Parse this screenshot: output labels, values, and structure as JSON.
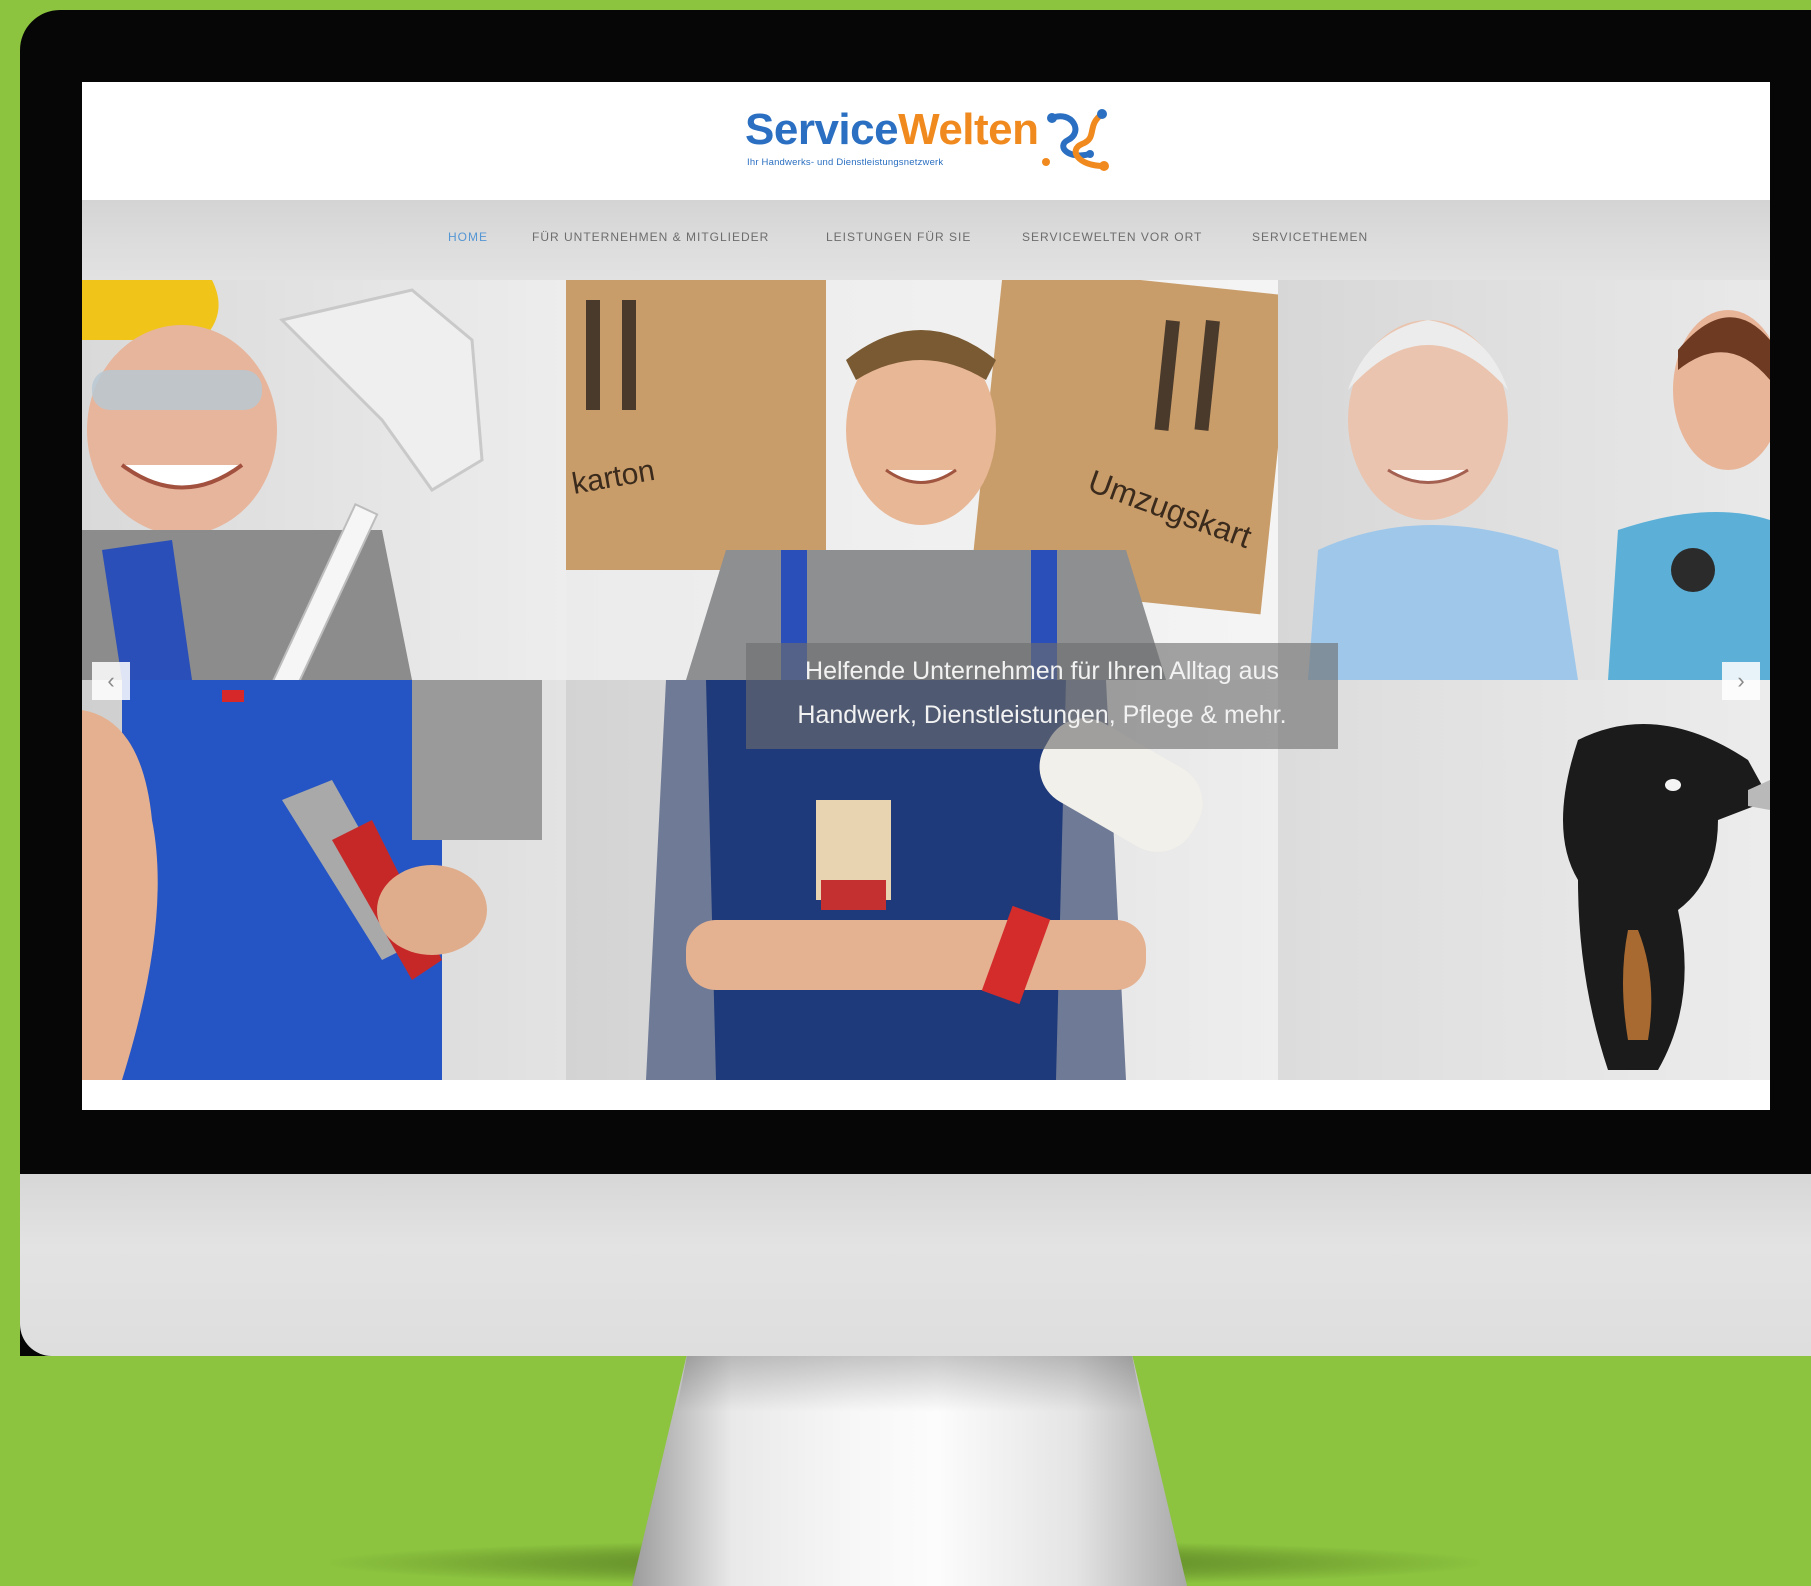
{
  "colors": {
    "background": "#8cc43f",
    "brand_blue": "#2a6fc1",
    "brand_orange": "#f08a1e",
    "nav_active": "#5596d4"
  },
  "site": {
    "logo": {
      "word_1": "Service",
      "word_2": "Welten",
      "tagline": "Ihr Handwerks- und Dienstleistungsnetzwerk"
    },
    "nav": {
      "items": [
        {
          "label": "HOME",
          "active": true
        },
        {
          "label": "FÜR UNTERNEHMEN & MITGLIEDER",
          "active": false
        },
        {
          "label": "LEISTUNGEN FÜR SIE",
          "active": false
        },
        {
          "label": "SERVICEWELTEN VOR ORT",
          "active": false
        },
        {
          "label": "SERVICETHEMEN",
          "active": false
        }
      ]
    },
    "hero": {
      "caption_line_1": "Helfende Unternehmen für Ihren Alltag aus",
      "caption_line_2": "Handwerk, Dienstleistungen, Pflege & mehr.",
      "prev_icon": "chevron-left-icon",
      "next_icon": "chevron-right-icon",
      "prev_glyph": "‹",
      "next_glyph": "›",
      "box_label_1": "karton",
      "box_label_2": "Umzugskart"
    }
  }
}
